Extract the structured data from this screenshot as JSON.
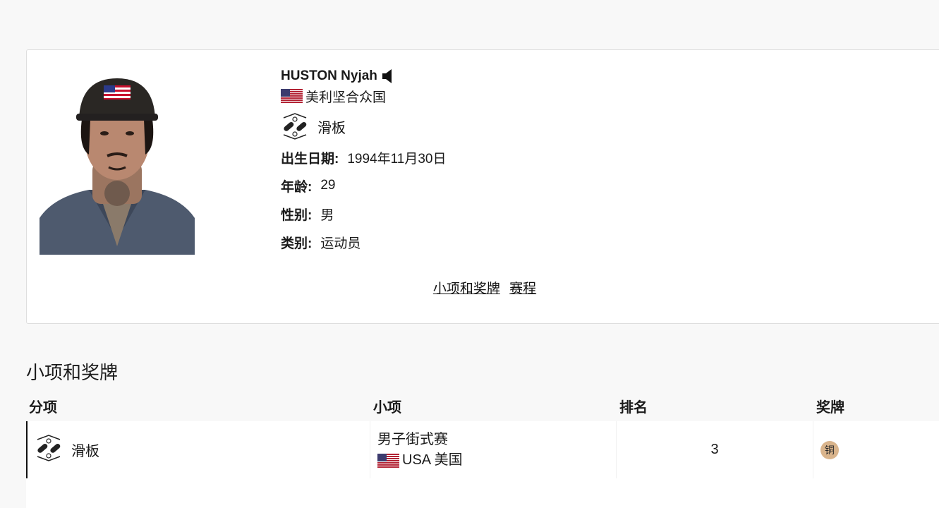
{
  "athlete": {
    "name": "HUSTON Nyjah",
    "country": "美利坚合众国",
    "sport": "滑板",
    "fields": [
      {
        "label": "出生日期:",
        "value": "1994年11月30日"
      },
      {
        "label": "年龄:",
        "value": "29"
      },
      {
        "label": "性别:",
        "value": "男"
      },
      {
        "label": "类别:",
        "value": "运动员"
      }
    ],
    "links": [
      "小项和奖牌",
      "赛程"
    ]
  },
  "medals_section": {
    "title": "小项和奖牌",
    "columns": [
      "分项",
      "小项",
      "排名",
      "奖牌"
    ],
    "rows": [
      {
        "discipline": "滑板",
        "event": "男子街式赛",
        "team": "USA 美国",
        "rank": "3",
        "medal": "铜",
        "medal_color": "#d9b48c"
      }
    ]
  },
  "icons": {
    "audio": "speaker-icon",
    "flag": "usa-flag-icon",
    "sport": "skateboarding-pictogram-icon"
  }
}
